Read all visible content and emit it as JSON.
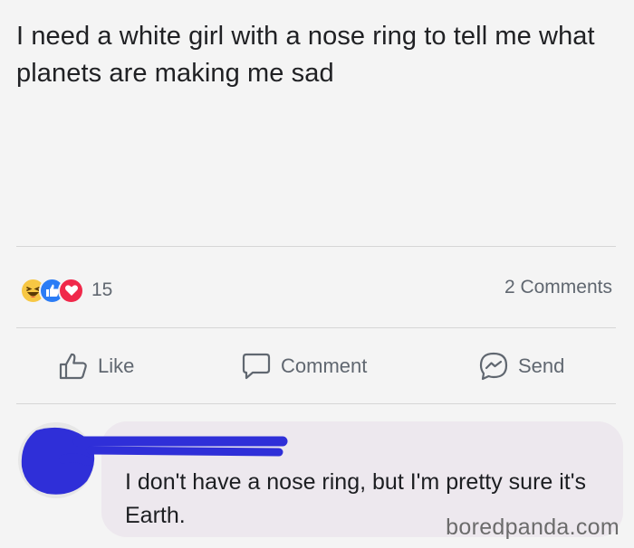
{
  "post": {
    "text": "I need a white girl with a nose ring to tell me what planets are making me sad",
    "reactions": {
      "icons": [
        "haha-icon",
        "like-icon",
        "love-icon"
      ],
      "count": "15"
    },
    "comments_count": "2 Comments"
  },
  "actions": {
    "like_label": "Like",
    "comment_label": "Comment",
    "send_label": "Send"
  },
  "comment": {
    "text": "I don't have a nose ring, but I'm pretty sure it's Earth."
  },
  "watermark": "boredpanda.com",
  "colors": {
    "background": "#f4f4f4",
    "reaction_like": "#2b7cf5",
    "reaction_love": "#f0284a",
    "reaction_haha": "#f7c744",
    "censor_scribble": "#2f2fd8",
    "comment_bubble": "#ede8ee"
  }
}
